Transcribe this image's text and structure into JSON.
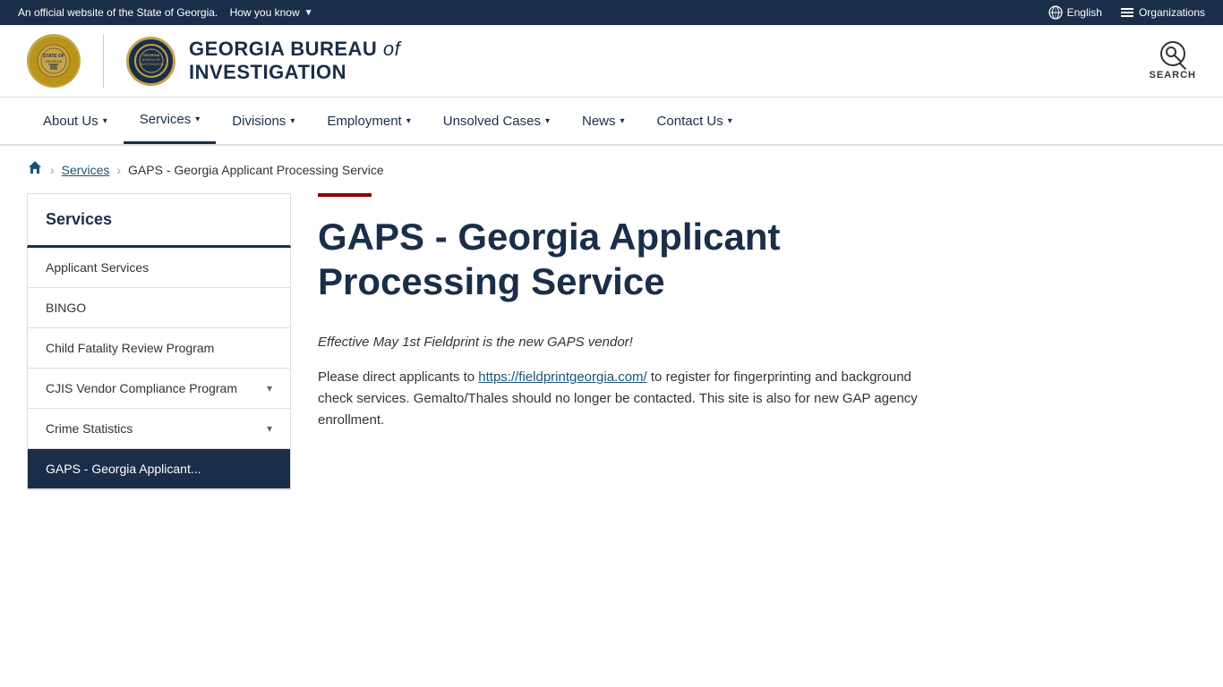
{
  "topbar": {
    "official_text": "An official website of the State of Georgia.",
    "how_you_know": "How you know",
    "english_label": "English",
    "organizations_label": "Organizations"
  },
  "header": {
    "agency_name_prefix": "GEORGIA BUREAU ",
    "agency_name_of": "of",
    "agency_name_suffix": "INVESTIGATION",
    "search_label": "SEARCH"
  },
  "nav": {
    "items": [
      {
        "label": "About Us",
        "has_dropdown": true
      },
      {
        "label": "Services",
        "has_dropdown": true,
        "active": true
      },
      {
        "label": "Divisions",
        "has_dropdown": true
      },
      {
        "label": "Employment",
        "has_dropdown": true
      },
      {
        "label": "Unsolved Cases",
        "has_dropdown": true
      },
      {
        "label": "News",
        "has_dropdown": true
      },
      {
        "label": "Contact Us",
        "has_dropdown": true
      }
    ]
  },
  "breadcrumb": {
    "home_label": "Home",
    "services_label": "Services",
    "current_label": "GAPS - Georgia Applicant Processing Service"
  },
  "sidebar": {
    "title": "Services",
    "items": [
      {
        "label": "Applicant Services",
        "has_expand": false,
        "active": false
      },
      {
        "label": "BINGO",
        "has_expand": false,
        "active": false
      },
      {
        "label": "Child Fatality Review Program",
        "has_expand": false,
        "active": false
      },
      {
        "label": "CJIS Vendor Compliance Program",
        "has_expand": true,
        "active": false
      },
      {
        "label": "Crime Statistics",
        "has_expand": true,
        "active": false
      },
      {
        "label": "GAPS - Georgia Applicant...",
        "has_expand": false,
        "active": true
      }
    ]
  },
  "content": {
    "title": "GAPS - Georgia Applicant Processing Service",
    "notice_text": "Effective May 1st Fieldprint is the new GAPS vendor!",
    "body_part1": "Please direct applicants to ",
    "link_text": "https://fieldprintgeorgia.com/",
    "link_url": "https://fieldprintgeorgia.com/",
    "body_part2": " to register for fingerprinting and background check services. Gemalto/Thales should no longer be contacted. This site is also for new GAP agency enrollment."
  }
}
